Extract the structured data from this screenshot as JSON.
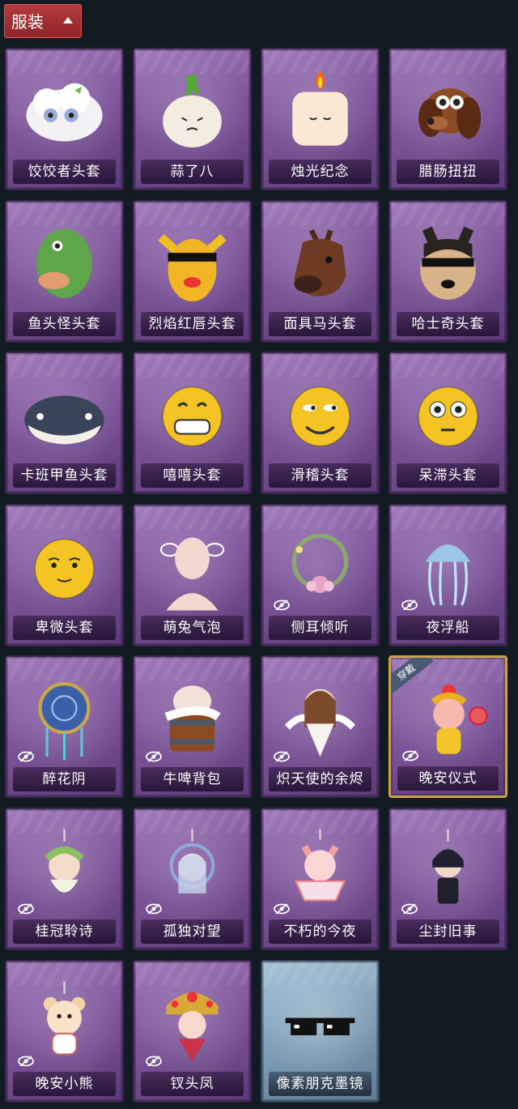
{
  "header": {
    "tab_label": "服装"
  },
  "equip_label": "穿戴",
  "items": [
    {
      "name": "饺饺者头套",
      "art": "dumpling-head-icon",
      "hidden_icon": false
    },
    {
      "name": "蒜了八",
      "art": "garlic-head-icon",
      "hidden_icon": false
    },
    {
      "name": "烛光纪念",
      "art": "candle-head-icon",
      "hidden_icon": false
    },
    {
      "name": "腊肠扭扭",
      "art": "dachshund-head-icon",
      "hidden_icon": false
    },
    {
      "name": "鱼头怪头套",
      "art": "fish-head-icon",
      "hidden_icon": false
    },
    {
      "name": "烈焰红唇头套",
      "art": "lips-mask-icon",
      "hidden_icon": false
    },
    {
      "name": "面具马头套",
      "art": "horse-mask-icon",
      "hidden_icon": false
    },
    {
      "name": "哈士奇头套",
      "art": "husky-mask-icon",
      "hidden_icon": false
    },
    {
      "name": "卡班甲鱼头套",
      "art": "whale-head-icon",
      "hidden_icon": false
    },
    {
      "name": "嘻嘻头套",
      "art": "grin-emoji-icon",
      "hidden_icon": false
    },
    {
      "name": "滑稽头套",
      "art": "smirk-emoji-icon",
      "hidden_icon": false
    },
    {
      "name": "呆滞头套",
      "art": "stare-emoji-icon",
      "hidden_icon": false
    },
    {
      "name": "卑微头套",
      "art": "humble-emoji-icon",
      "hidden_icon": false
    },
    {
      "name": "萌兔气泡",
      "art": "bubble-head-icon",
      "hidden_icon": false
    },
    {
      "name": "侧耳倾听",
      "art": "flower-wreath-icon",
      "hidden_icon": true
    },
    {
      "name": "夜浮船",
      "art": "jellyfish-icon",
      "hidden_icon": true
    },
    {
      "name": "醉花阴",
      "art": "dreamcatcher-icon",
      "hidden_icon": true
    },
    {
      "name": "牛啤背包",
      "art": "beer-cow-icon",
      "hidden_icon": true
    },
    {
      "name": "炽天使的余烬",
      "art": "angel-doll-icon",
      "hidden_icon": true
    },
    {
      "name": "晚安仪式",
      "art": "pig-doll-icon",
      "hidden_icon": true,
      "equipped": true
    },
    {
      "name": "桂冠聆诗",
      "art": "laurel-charm-icon",
      "hidden_icon": true
    },
    {
      "name": "孤独对望",
      "art": "lonely-charm-icon",
      "hidden_icon": true
    },
    {
      "name": "不朽的今夜",
      "art": "fox-sundae-icon",
      "hidden_icon": true
    },
    {
      "name": "尘封旧事",
      "art": "dark-doll-charm-icon",
      "hidden_icon": true
    },
    {
      "name": "晚安小熊",
      "art": "bear-charm-icon",
      "hidden_icon": true
    },
    {
      "name": "钗头凤",
      "art": "phoenix-crown-icon",
      "hidden_icon": true
    },
    {
      "name": "像素朋克墨镜",
      "art": "pixel-sunglasses-icon",
      "hidden_icon": false,
      "blue": true
    }
  ]
}
